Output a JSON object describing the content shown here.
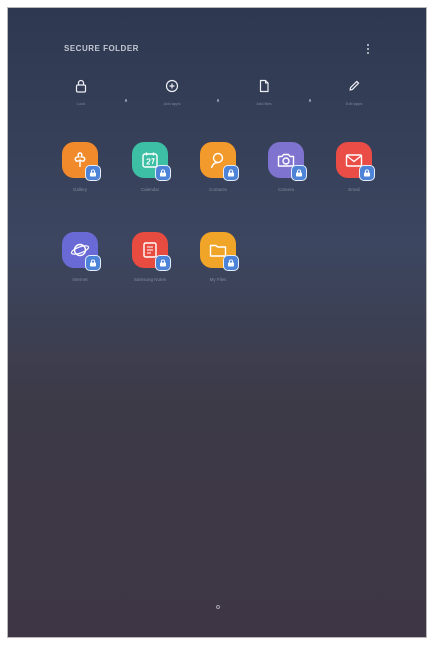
{
  "header": {
    "title": "SECURE FOLDER",
    "more_icon": "more-vertical-icon"
  },
  "actions": [
    {
      "label": "Lock",
      "icon": "lock-icon"
    },
    {
      "label": "Add apps",
      "icon": "add-circle-icon"
    },
    {
      "label": "Add files",
      "icon": "file-icon"
    },
    {
      "label": "Edit apps",
      "icon": "pencil-icon"
    }
  ],
  "apps": [
    {
      "label": "Gallery",
      "icon": "gallery-icon",
      "color": "#f08a2a"
    },
    {
      "label": "Calendar",
      "icon": "calendar-icon",
      "color": "#3cbfa4"
    },
    {
      "label": "Contacts",
      "icon": "contacts-icon",
      "color": "#f29a2b"
    },
    {
      "label": "Camera",
      "icon": "camera-icon",
      "color": "#7f73d0"
    },
    {
      "label": "Email",
      "icon": "email-icon",
      "color": "#ea4d45"
    },
    {
      "label": "Internet",
      "icon": "internet-icon",
      "color": "#6a6ad6"
    },
    {
      "label": "Samsung Notes",
      "icon": "notes-icon",
      "color": "#e84b3f"
    },
    {
      "label": "My Files",
      "icon": "folder-icon",
      "color": "#f0a428"
    }
  ],
  "colors": {
    "badge": "#4e84d8",
    "background_top": "#2e3850",
    "background_bottom": "#3e3644"
  }
}
